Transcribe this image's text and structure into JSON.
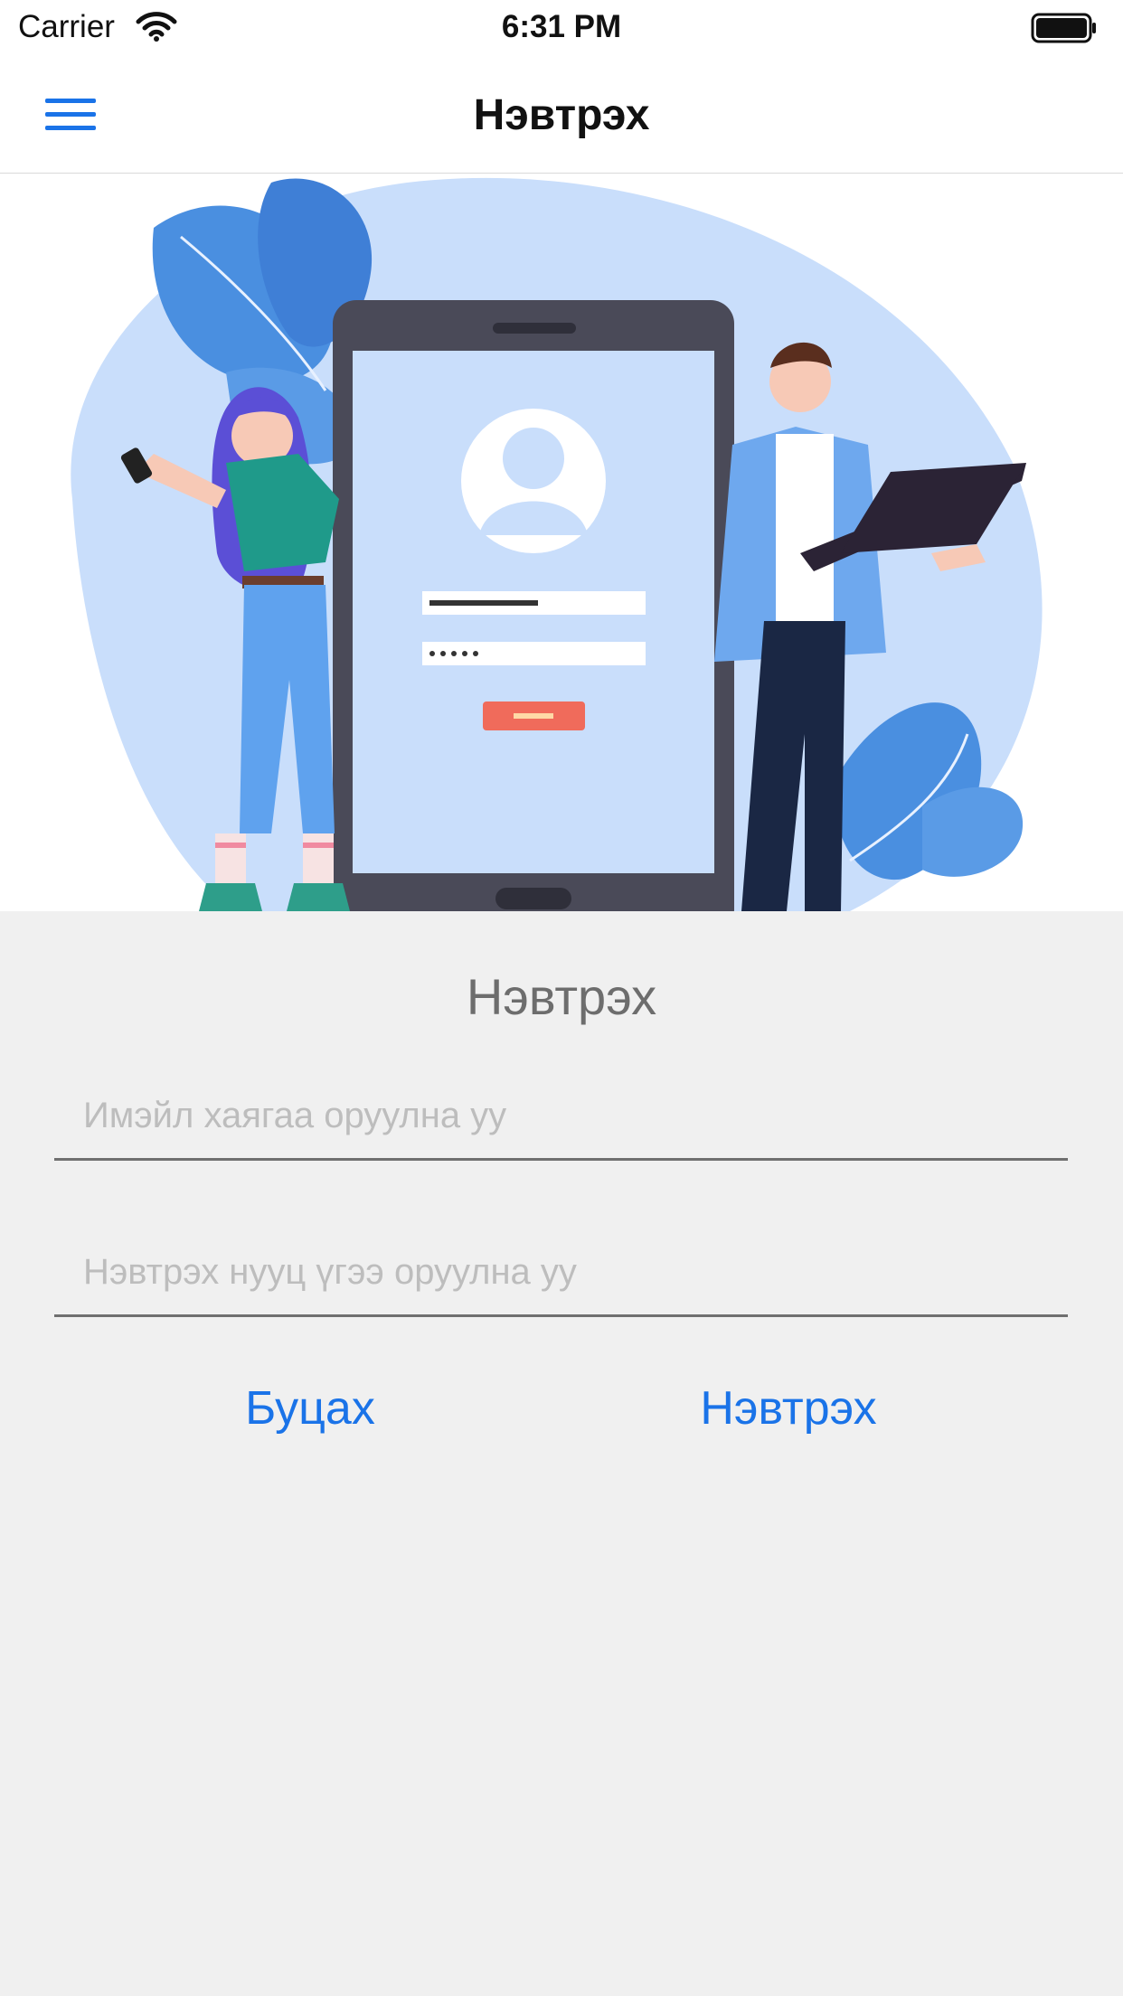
{
  "status_bar": {
    "carrier": "Carrier",
    "time": "6:31 PM"
  },
  "nav": {
    "title": "Нэвтрэх",
    "menu_icon": "hamburger-menu-icon"
  },
  "hero": {
    "image": "login-illustration"
  },
  "form": {
    "title": "Нэвтрэх",
    "email_placeholder": "Имэйл хаягаа оруулна уу",
    "email_value": "",
    "password_placeholder": "Нэвтрэх нууц үгээ оруулна уу",
    "password_value": ""
  },
  "actions": {
    "back_label": "Буцах",
    "login_label": "Нэвтрэх"
  },
  "colors": {
    "accent": "#1a73e8",
    "background": "#f0f0f0",
    "placeholder": "#bdbdbd"
  }
}
